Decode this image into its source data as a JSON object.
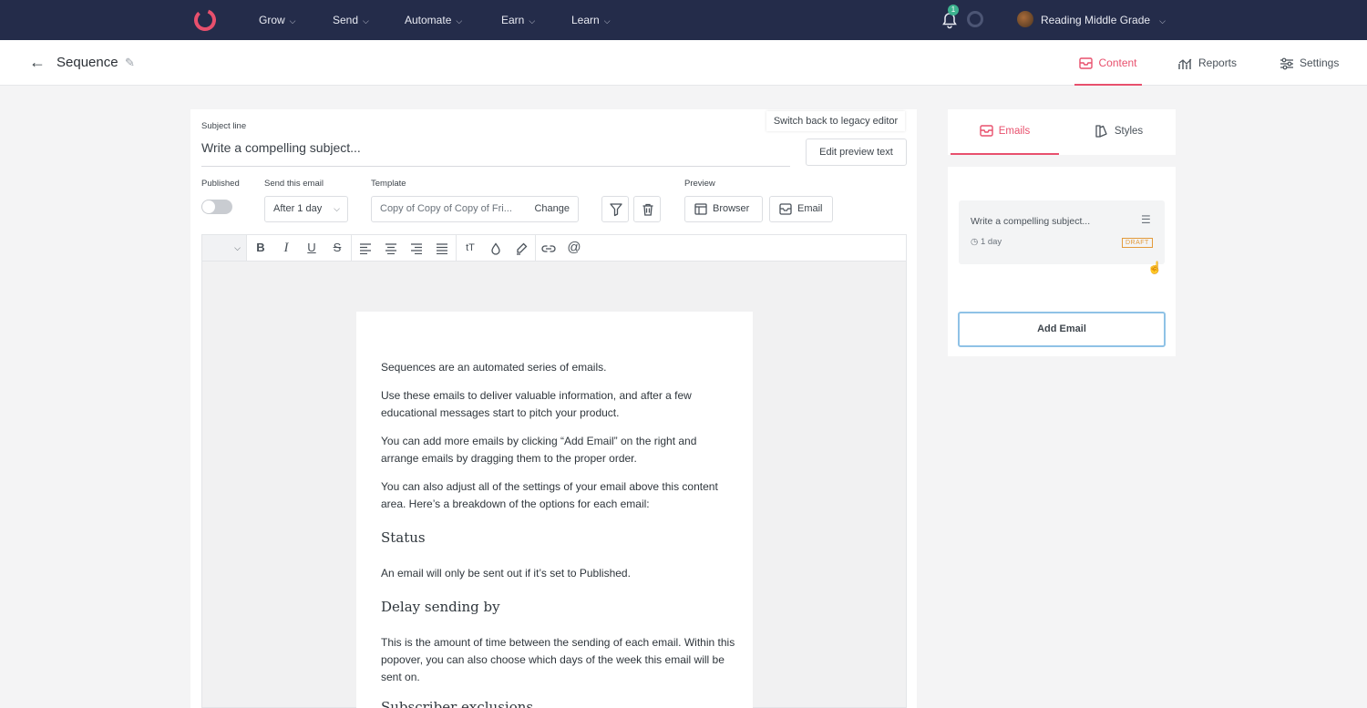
{
  "topnav": {
    "menu": [
      {
        "label": "Grow"
      },
      {
        "label": "Send"
      },
      {
        "label": "Automate"
      },
      {
        "label": "Earn"
      },
      {
        "label": "Learn"
      }
    ],
    "notification_count": "1",
    "account_name": "Reading Middle Grade",
    "brand_color": "#e8506d",
    "bg_color": "#242c4a"
  },
  "subheader": {
    "title": "Sequence",
    "tabs": {
      "content": "Content",
      "reports": "Reports",
      "settings": "Settings"
    }
  },
  "editor": {
    "subject_label": "Subject line",
    "subject_value": "Write a compelling subject...",
    "legacy_link": "Switch back to legacy editor",
    "edit_preview_text": "Edit preview text",
    "published_label": "Published",
    "published": false,
    "send_label": "Send this email",
    "send_value": "After 1 day",
    "template_label": "Template",
    "template_value": "Copy of Copy of Copy of Fri...",
    "template_change": "Change",
    "preview_label": "Preview",
    "preview_browser": "Browser",
    "preview_email": "Email",
    "toolbar_icons": [
      "bold-icon",
      "italic-icon",
      "underline-icon",
      "strikethrough-icon",
      "align-left-icon",
      "align-center-icon",
      "align-right-icon",
      "align-justify-icon",
      "text-size-icon",
      "color-icon",
      "highlight-icon",
      "link-icon",
      "mention-icon"
    ],
    "body": {
      "p1": "Sequences are an automated series of emails.",
      "p2": "Use these emails to deliver valuable information, and after a few educational messages start to pitch your product.",
      "p3": "You can add more emails by clicking “Add Email” on the right and arrange emails by dragging them to the proper order.",
      "p4": "You can also adjust all of the settings of your email above this content area. Here’s a breakdown of the options for each email:",
      "h_status": "Status",
      "p5": "An email will only be sent out if it’s set to Published.",
      "h_delay": "Delay sending by",
      "p6": "This is the amount of time between the sending of each email. Within this popover, you can also choose which days of the week this email will be sent on.",
      "h_next": "Subscriber exclusions"
    }
  },
  "right_panel": {
    "tabs": {
      "emails": "Emails",
      "styles": "Styles"
    },
    "email_card": {
      "title": "Write a compelling subject...",
      "delay": "1 day",
      "status": "DRAFT"
    },
    "add_email": "Add Email"
  }
}
